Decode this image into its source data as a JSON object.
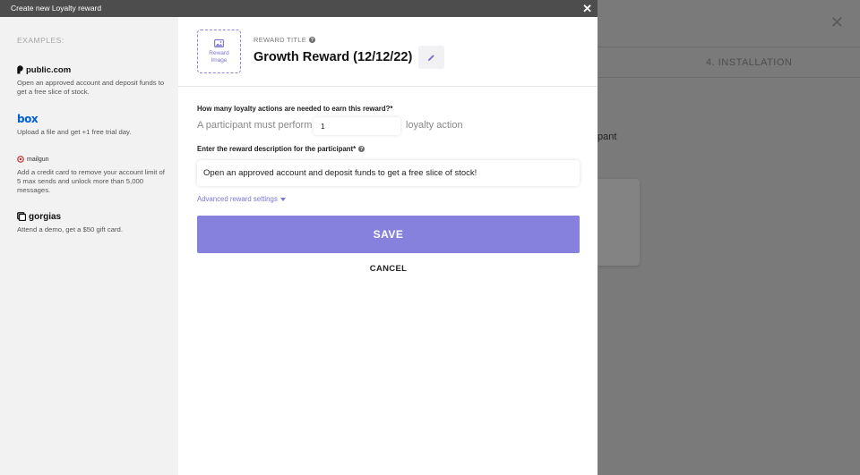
{
  "background": {
    "close_icon": "close-icon",
    "step_label": "4. INSTALLATION",
    "partial_text": "pant"
  },
  "modal": {
    "title": "Create new Loyalty reward",
    "close_glyph": "✕"
  },
  "sidebar": {
    "examples_label": "EXAMPLES:",
    "examples": [
      {
        "brand": "public.com",
        "icon": "public-logo",
        "description": "Open an approved account and deposit funds to get a free slice of stock."
      },
      {
        "brand": "box",
        "icon": "box-logo",
        "description": "Upload a file and get +1 free trial day."
      },
      {
        "brand": "mailgun",
        "icon": "mailgun-logo",
        "description": "Add a credit card to remove your account limit of 5 max sends and unlock more than 5,000 messages."
      },
      {
        "brand": "gorgias",
        "icon": "gorgias-logo",
        "description": "Attend a demo, get a $50 gift card."
      }
    ]
  },
  "form": {
    "image_label_line1": "Reward",
    "image_label_line2": "Image",
    "title_label": "REWARD TITLE",
    "reward_title": "Growth Reward (12/12/22)",
    "actions_question": "How many loyalty actions are needed to earn this reward?*",
    "participant_prefix": "A participant must perform",
    "actions_value": "1",
    "participant_suffix": "loyalty action",
    "description_question": "Enter the reward description for the participant*",
    "description_value": "Open an approved account and deposit funds to get a free slice of stock!",
    "advanced_label": "Advanced reward settings",
    "save_label": "SAVE",
    "cancel_label": "CANCEL"
  },
  "colors": {
    "accent": "#8681dd",
    "header": "#4d4d4d",
    "sidebar_bg": "#f2f2f2"
  }
}
